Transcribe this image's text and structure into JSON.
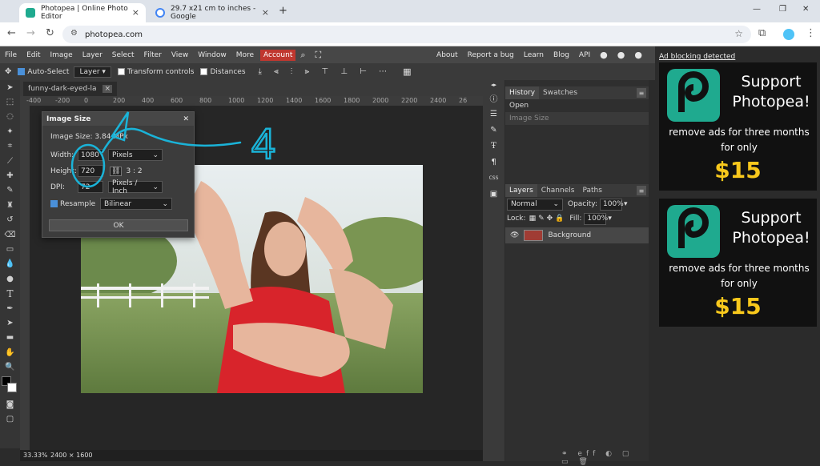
{
  "browser": {
    "tabs": [
      {
        "title": "Photopea | Online Photo Editor"
      },
      {
        "title": "29.7 x21 cm to inches - Google"
      }
    ],
    "new_tab": "+",
    "url": "photopea.com",
    "window_controls": [
      "—",
      "❐",
      "✕"
    ]
  },
  "menu": {
    "items": [
      "File",
      "Edit",
      "Image",
      "Layer",
      "Select",
      "Filter",
      "View",
      "Window",
      "More"
    ],
    "account": "Account",
    "right": [
      "About",
      "Report a bug",
      "Learn",
      "Blog",
      "API"
    ]
  },
  "options": {
    "auto_select": "Auto-Select",
    "layer_select": "Layer",
    "transform": "Transform controls",
    "distances": "Distances"
  },
  "document": {
    "tab_name": "funny-dark-eyed-la",
    "ruler_marks": [
      "-400",
      "-200",
      "0",
      "200",
      "400",
      "600",
      "800",
      "1000",
      "1200",
      "1400",
      "1600",
      "1800",
      "2000",
      "2200",
      "2400",
      "26"
    ],
    "zoom": "33.33%",
    "size": "2400 × 1600"
  },
  "dialog": {
    "title": "Image Size",
    "image_size": "Image Size: 3.84 MPx",
    "width_label": "Width:",
    "width_value": "1080",
    "width_unit": "Pixels",
    "height_label": "Height:",
    "height_value": "720",
    "ratio": "3 : 2",
    "dpi_label": "DPI:",
    "dpi_value": "72",
    "dpi_unit": "Pixels / Inch",
    "resample_label": "Resample",
    "resample_method": "Bilinear",
    "ok": "OK",
    "close": "✕"
  },
  "annotation": {
    "number": "4"
  },
  "history": {
    "tabs": [
      "History",
      "Swatches"
    ],
    "items": [
      "Open",
      "Image Size"
    ]
  },
  "layers": {
    "tabs": [
      "Layers",
      "Channels",
      "Paths"
    ],
    "blend": "Normal",
    "opacity_label": "Opacity:",
    "opacity": "100%",
    "lock_label": "Lock:",
    "fill_label": "Fill:",
    "fill": "100%",
    "layer_name": "Background"
  },
  "ads": {
    "notice": "Ad blocking detected",
    "title": "Support Photopea!",
    "subtitle": "remove ads for three months for only",
    "price": "$15"
  },
  "colors": {
    "accent": "#1faa8f",
    "price": "#f8c81c",
    "account": "#c0372f",
    "annotation": "#1ab3d8"
  }
}
